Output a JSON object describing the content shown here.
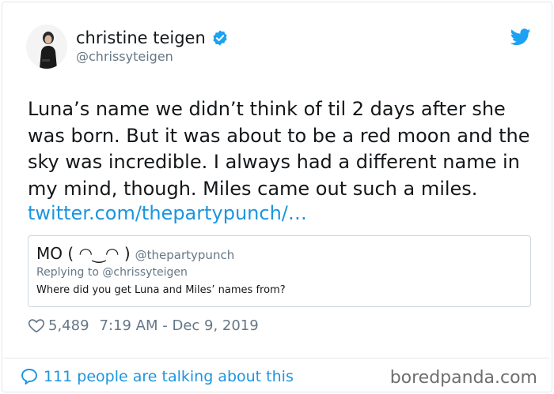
{
  "tweet": {
    "author_name": "christine teigen",
    "author_handle": "@chrissyteigen",
    "text_lines": [
      "Luna’s name we didn’t think of til 2 days after she",
      "was born. But it was about to be a red moon and the",
      "sky was incredible. I always had a different name in",
      "my mind, though. Miles came out such a miles."
    ],
    "link": "twitter.com/thepartypunch/…",
    "likes": "5,489",
    "timestamp": "7:19 AM - Dec 9, 2019",
    "talking": "111 people are talking about this"
  },
  "quote": {
    "name": "MO ( ◠‿◠ )",
    "handle": "@thepartypunch",
    "replying_to": "Replying to @chrissyteigen",
    "text": "Where did you get Luna and Miles’ names from?"
  },
  "watermark": "boredpanda.com",
  "colors": {
    "link_blue": "#1b95e0",
    "twitter_blue": "#1da1f2",
    "muted_gray": "#657786",
    "border": "#e1e8ed"
  },
  "icons": {
    "verified": "verified-badge-icon",
    "bird": "twitter-bird-icon",
    "like": "heart-icon",
    "reply": "speech-bubble-icon"
  }
}
